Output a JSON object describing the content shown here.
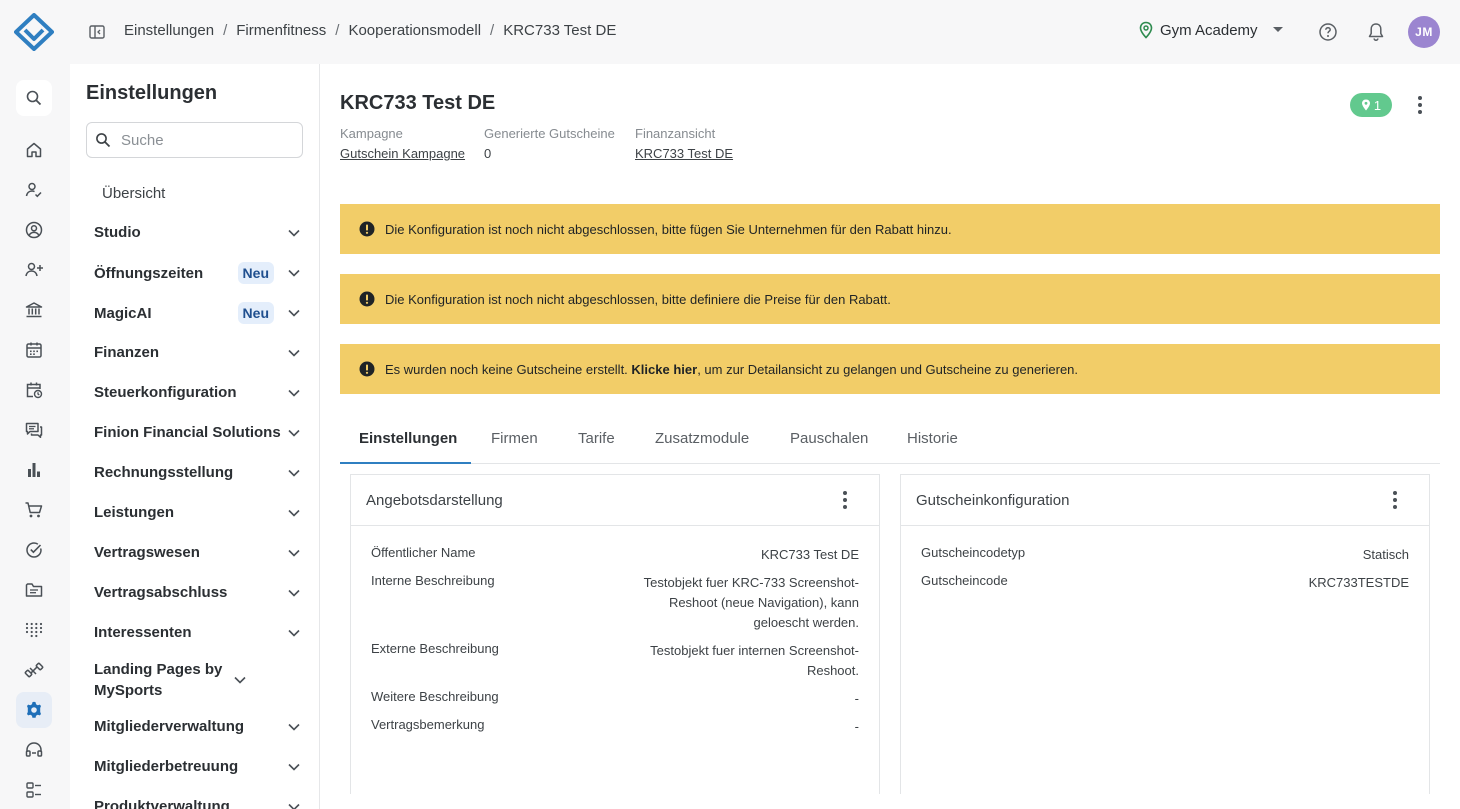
{
  "breadcrumb": [
    "Einstellungen",
    "Firmenfitness",
    "Kooperationsmodell",
    "KRC733 Test DE"
  ],
  "studio_name": "Gym Academy",
  "user_initials": "JM",
  "sidebar": {
    "title": "Einstellungen",
    "search_placeholder": "Suche",
    "overview": "Übersicht",
    "items": [
      {
        "label": "Studio",
        "badge": ""
      },
      {
        "label": "Öffnungszeiten",
        "badge": "Neu"
      },
      {
        "label": "MagicAI",
        "badge": "Neu"
      },
      {
        "label": "Finanzen",
        "badge": ""
      },
      {
        "label": "Steuerkonfiguration",
        "badge": ""
      },
      {
        "label": "Finion Financial Solutions",
        "badge": ""
      },
      {
        "label": "Rechnungsstellung",
        "badge": ""
      },
      {
        "label": "Leistungen",
        "badge": ""
      },
      {
        "label": "Vertragswesen",
        "badge": ""
      },
      {
        "label": "Vertragsabschluss",
        "badge": ""
      },
      {
        "label": "Interessenten",
        "badge": ""
      },
      {
        "label": "Landing Pages by MySports",
        "badge": ""
      },
      {
        "label": "Mitgliederverwaltung",
        "badge": ""
      },
      {
        "label": "Mitgliederbetreuung",
        "badge": ""
      },
      {
        "label": "Produktverwaltung",
        "badge": ""
      }
    ]
  },
  "page": {
    "title": "KRC733 Test DE",
    "location_count": "1",
    "meta": {
      "campaign_label": "Kampagne",
      "campaign_value": "Gutschein Kampagne",
      "vouchers_label": "Generierte Gutscheine",
      "vouchers_value": "0",
      "finance_label": "Finanzansicht",
      "finance_value": "KRC733 Test DE"
    },
    "alerts": {
      "a1": "Die Konfiguration ist noch nicht abgeschlossen, bitte fügen Sie Unternehmen für den Rabatt hinzu.",
      "a2": "Die Konfiguration ist noch nicht abgeschlossen, bitte definiere die Preise für den Rabatt.",
      "a3_pre": "Es wurden noch keine Gutscheine erstellt. ",
      "a3_link": "Klicke hier",
      "a3_post": ", um zur Detailansicht zu gelangen und Gutscheine zu generieren."
    },
    "tabs": [
      "Einstellungen",
      "Firmen",
      "Tarife",
      "Zusatzmodule",
      "Pauschalen",
      "Historie"
    ],
    "offer_card": {
      "title": "Angebotsdarstellung",
      "rows": [
        {
          "label": "Öffentlicher Name",
          "value": "KRC733 Test DE"
        },
        {
          "label": "Interne Beschreibung",
          "value": "Testobjekt fuer KRC-733 Screenshot-Reshoot (neue Navigation), kann geloescht werden."
        },
        {
          "label": "Externe Beschreibung",
          "value": "Testobjekt fuer internen Screenshot-Reshoot."
        },
        {
          "label": "Weitere Beschreibung",
          "value": "-"
        },
        {
          "label": "Vertragsbemerkung",
          "value": "-"
        }
      ]
    },
    "voucher_card": {
      "title": "Gutscheinkonfiguration",
      "rows": [
        {
          "label": "Gutscheincodetyp",
          "value": "Statisch"
        },
        {
          "label": "Gutscheincode",
          "value": "KRC733TESTDE"
        }
      ]
    }
  },
  "colors": {
    "accent": "#2f7fc1",
    "alert_bg": "#f2cd68",
    "avatar_bg": "#9b85d0",
    "location_badge": "#62c98e"
  }
}
